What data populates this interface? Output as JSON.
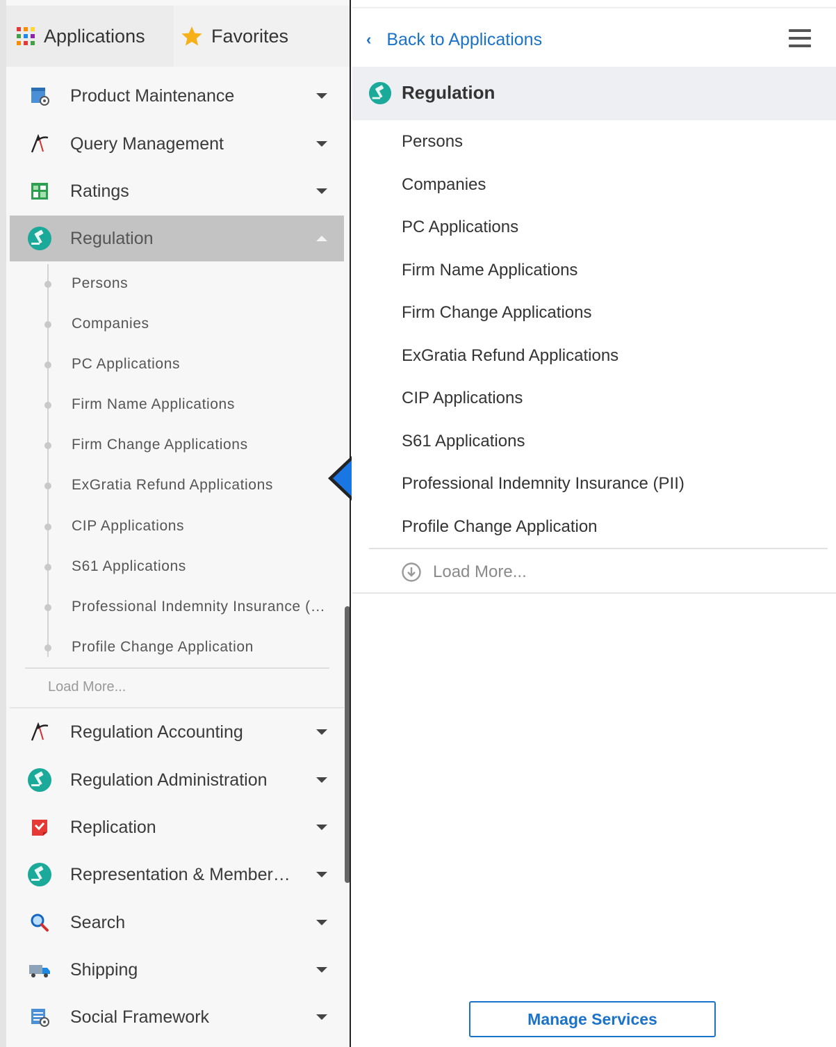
{
  "tabs": {
    "applications": "Applications",
    "favorites": "Favorites"
  },
  "left_nav": {
    "items_top": [
      {
        "label": "Product Maintenance",
        "icon": "product-maintenance-icon"
      },
      {
        "label": "Query Management",
        "icon": "query-management-icon"
      },
      {
        "label": "Ratings",
        "icon": "ratings-icon"
      }
    ],
    "active": {
      "label": "Regulation",
      "icon": "regulation-gavel-icon"
    },
    "sub_items": [
      "Persons",
      "Companies",
      "PC Applications",
      "Firm Name Applications",
      "Firm Change Applications",
      "ExGratia Refund Applications",
      "CIP Applications",
      "S61 Applications",
      "Professional Indemnity Insurance (…",
      "Profile Change Application"
    ],
    "load_more": "Load More...",
    "items_bottom": [
      {
        "label": "Regulation Accounting",
        "icon": "query-management-icon"
      },
      {
        "label": "Regulation Administration",
        "icon": "regulation-gavel-icon"
      },
      {
        "label": "Replication",
        "icon": "replication-icon"
      },
      {
        "label": "Representation & Member…",
        "icon": "regulation-gavel-icon"
      },
      {
        "label": "Search",
        "icon": "search-icon"
      },
      {
        "label": "Shipping",
        "icon": "truck-icon"
      },
      {
        "label": "Social Framework",
        "icon": "social-framework-icon"
      }
    ]
  },
  "right_panel": {
    "back_label": "Back to Applications",
    "title": "Regulation",
    "items": [
      "Persons",
      "Companies",
      "PC Applications",
      "Firm Name Applications",
      "Firm Change Applications",
      "ExGratia Refund Applications",
      "CIP Applications",
      "S61 Applications",
      "Professional Indemnity Insurance (PII)",
      "Profile Change Application"
    ],
    "load_more": "Load More...",
    "manage_button": "Manage Services"
  },
  "colors": {
    "accent_blue": "#1a73c9",
    "active_row": "#c3c3c3",
    "teal_icon": "#1ba99a",
    "star": "#f5b01a"
  }
}
